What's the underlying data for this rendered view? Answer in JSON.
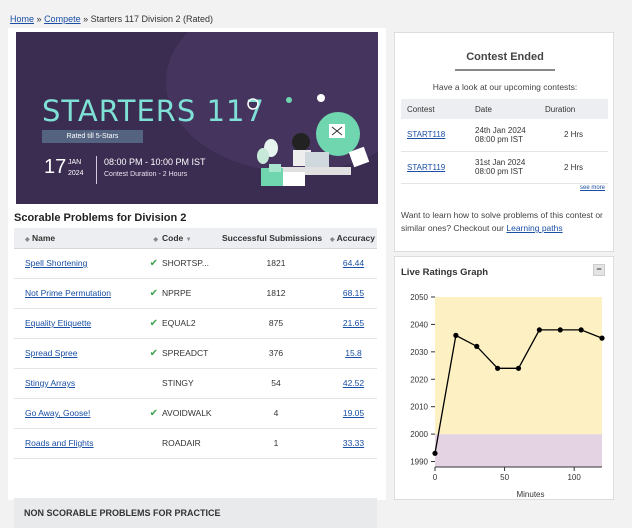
{
  "breadcrumb": {
    "home": "Home",
    "compete": "Compete",
    "current": "Starters 117 Division 2 (Rated)",
    "sep": "»"
  },
  "banner": {
    "title": "STARTERS 117",
    "rated": "Rated till 5-Stars",
    "day": "17",
    "month": "JAN",
    "year": "2024",
    "time": "08:00 PM - 10:00 PM IST",
    "duration": "Contest Duration - 2 Hours"
  },
  "section_title": "Scorable Problems for Division 2",
  "table": {
    "headers": {
      "name": "Name",
      "code": "Code",
      "submissions": "Successful Submissions",
      "accuracy": "Accuracy"
    },
    "rows": [
      {
        "name": "Spell Shortening",
        "solved": true,
        "code": "SHORTSP...",
        "subs": "1821",
        "acc": "64.44"
      },
      {
        "name": "Not Prime Permutation",
        "solved": true,
        "code": "NPRPE",
        "subs": "1812",
        "acc": "68.15"
      },
      {
        "name": "Equality Etiquette",
        "solved": true,
        "code": "EQUAL2",
        "subs": "875",
        "acc": "21.65"
      },
      {
        "name": "Spread Spree",
        "solved": true,
        "code": "SPREADCT",
        "subs": "376",
        "acc": "15.8"
      },
      {
        "name": "Stingy Arrays",
        "solved": false,
        "code": "STINGY",
        "subs": "54",
        "acc": "42.52"
      },
      {
        "name": "Go Away, Goose!",
        "solved": true,
        "code": "AVOIDWALK",
        "subs": "4",
        "acc": "19.05"
      },
      {
        "name": "Roads and Flights",
        "solved": false,
        "code": "ROADAIR",
        "subs": "1",
        "acc": "33.33"
      }
    ]
  },
  "nonscorable": "NON SCORABLE PROBLEMS FOR PRACTICE",
  "contest_panel": {
    "ended": "Contest Ended",
    "sub": "Have a look at our upcoming contests:",
    "headers": {
      "contest": "Contest",
      "date": "Date",
      "duration": "Duration"
    },
    "rows": [
      {
        "contest": "START118",
        "date1": "24th Jan 2024",
        "date2": "08:00 pm IST",
        "duration": "2 Hrs"
      },
      {
        "contest": "START119",
        "date1": "31st Jan 2024",
        "date2": "08:00 pm IST",
        "duration": "2 Hrs"
      }
    ],
    "see_more": "see more",
    "learn_text": "Want to learn how to solve problems of this contest or similar ones? Checkout our",
    "learn_link": "Learning paths"
  },
  "graph": {
    "title": "Live Ratings Graph",
    "collapse": "−",
    "xlabel": "Minutes"
  },
  "chart_data": {
    "type": "line",
    "x": [
      0,
      15,
      30,
      45,
      60,
      75,
      90,
      105,
      120
    ],
    "series": [
      {
        "values": [
          1993,
          2036,
          2032,
          2024,
          2024,
          2038,
          2038,
          2038,
          2035
        ],
        "color": "#000000"
      }
    ],
    "xlim": [
      0,
      120
    ],
    "ylim": [
      1988,
      2050
    ],
    "yticks": [
      1990,
      2000,
      2010,
      2020,
      2030,
      2040,
      2050
    ],
    "xticks": [
      0,
      50,
      100
    ],
    "xlabel": "Minutes",
    "bands": [
      {
        "from": 1988,
        "to": 2000,
        "color": "#e4d3e3"
      },
      {
        "from": 2000,
        "to": 2050,
        "color": "#fdf1c4"
      }
    ],
    "grid": false
  }
}
